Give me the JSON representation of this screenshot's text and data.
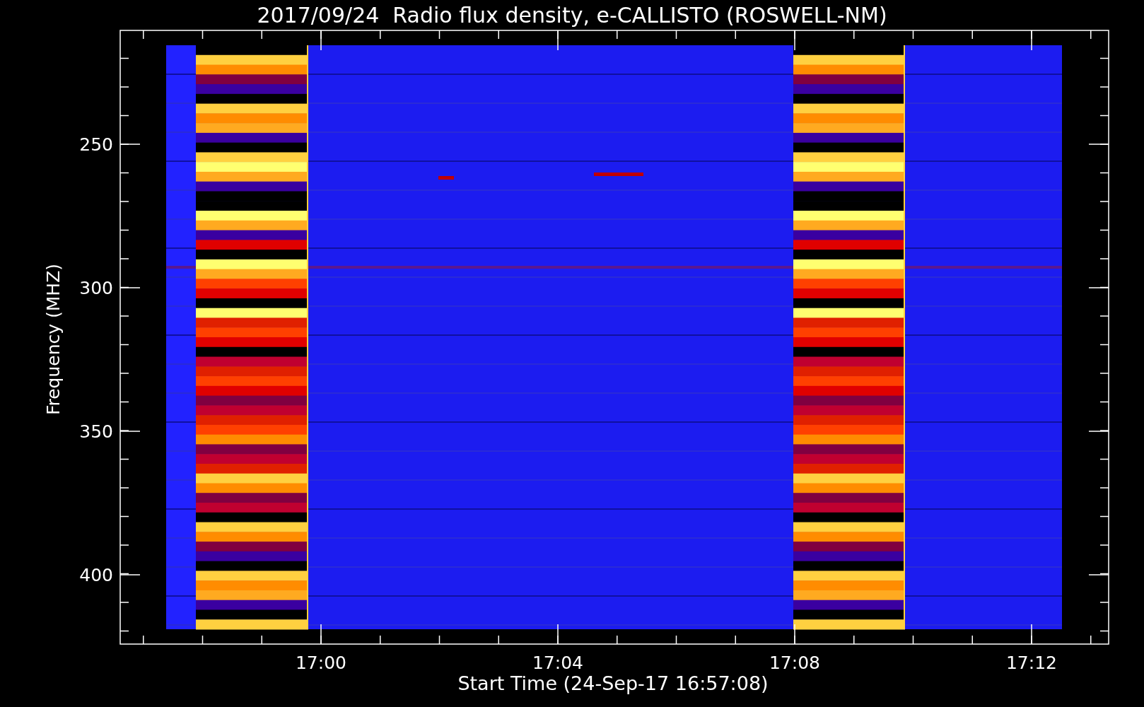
{
  "title": "2017/09/24  Radio flux density, e-CALLISTO (ROSWELL-NM)",
  "y_axis": {
    "label": "Frequency (MHZ)",
    "ticks": [
      "250",
      "300",
      "350",
      "400"
    ]
  },
  "x_axis": {
    "label": "Start Time (24-Sep-17 16:57:08)",
    "ticks": [
      "17:00",
      "17:04",
      "17:08",
      "17:12"
    ]
  }
}
